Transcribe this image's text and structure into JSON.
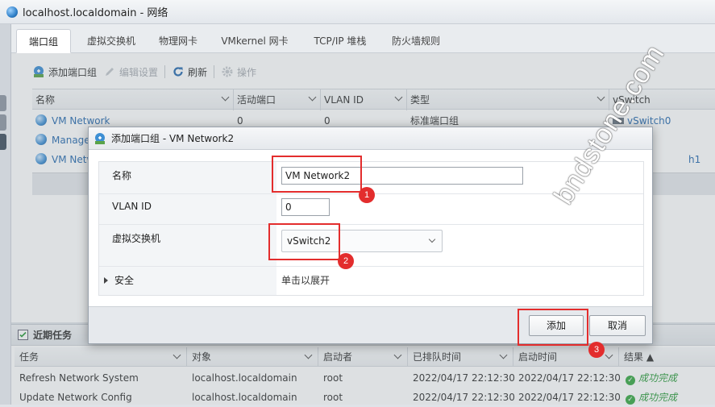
{
  "window": {
    "title": "localhost.localdomain - 网络"
  },
  "tabs": [
    {
      "label": "端口组",
      "active": true
    },
    {
      "label": "虚拟交换机"
    },
    {
      "label": "物理网卡"
    },
    {
      "label": "VMkernel 网卡"
    },
    {
      "label": "TCP/IP 堆栈"
    },
    {
      "label": "防火墙规则"
    }
  ],
  "toolbar": {
    "add_portgroup": "添加端口组",
    "edit_settings": "编辑设置",
    "refresh": "刷新",
    "actions": "操作"
  },
  "portgroups": {
    "columns": [
      "名称",
      "活动端口",
      "VLAN ID",
      "类型",
      "vSwitch"
    ],
    "rows": [
      {
        "name": "VM Network",
        "active_ports": "0",
        "vlan": "0",
        "type": "标准端口组",
        "vswitch": "vSwitch0"
      },
      {
        "name": "Manager",
        "active_ports": "",
        "vlan": "",
        "type": "",
        "vswitch": ""
      },
      {
        "name": "VM Netw",
        "active_ports": "",
        "vlan": "",
        "type": "",
        "vswitch": "h1"
      }
    ]
  },
  "dialog": {
    "title": "添加端口组 - VM Network2",
    "name_label": "名称",
    "name_value": "VM Network2",
    "vlan_label": "VLAN ID",
    "vlan_value": "0",
    "vswitch_label": "虚拟交换机",
    "vswitch_value": "vSwitch2",
    "security_label": "安全",
    "security_value": "单击以展开",
    "add_button": "添加",
    "cancel_button": "取消"
  },
  "recent_tasks": {
    "title": "近期任务",
    "columns": [
      "任务",
      "对象",
      "启动者",
      "已排队时间",
      "启动时间",
      "结果 ▲"
    ],
    "rows": [
      {
        "task": "Refresh Network System",
        "target": "localhost.localdomain",
        "initiator": "root",
        "queued": "2022/04/17 22:12:30",
        "started": "2022/04/17 22:12:30",
        "result": "成功完成"
      },
      {
        "task": "Update Network Config",
        "target": "localhost.localdomain",
        "initiator": "root",
        "queued": "2022/04/17 22:12:30",
        "started": "2022/04/17 22:12:30",
        "result": "成功完成"
      }
    ]
  },
  "annotations": {
    "b1": "1",
    "b2": "2",
    "b3": "3"
  },
  "watermark": "bndstone.com",
  "colors": {
    "highlight": "#e32d2d",
    "link": "#2a6cb0",
    "success": "#2a9a3a"
  }
}
